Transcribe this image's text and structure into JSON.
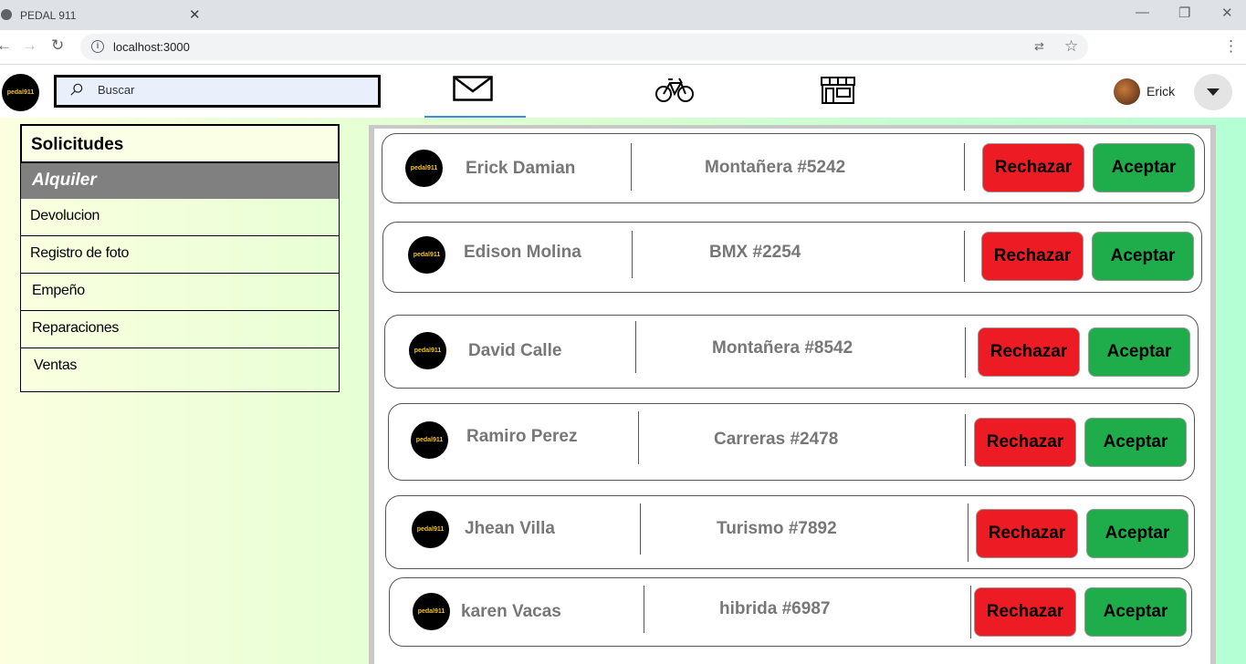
{
  "browser": {
    "tab_title": "PEDAL 911",
    "tab_close": "✕",
    "url": "localhost:3000",
    "controls": {
      "minimize": "—",
      "restore": "❐",
      "close": "✕"
    }
  },
  "header": {
    "logo_text": "pedal911",
    "search_placeholder": "Buscar",
    "user_name": "Erick",
    "nav_icons": [
      "mail-icon",
      "bicycle-icon",
      "store-icon"
    ]
  },
  "sidebar": {
    "title": "Solicitudes",
    "active": "Alquiler",
    "items": [
      "Devolucion",
      "Registro de foto",
      "Empeño",
      "Reparaciones",
      "Ventas"
    ]
  },
  "requests": [
    {
      "name": "Erick Damian",
      "bike": "Montañera #5242"
    },
    {
      "name": "Edison  Molina",
      "bike": "BMX #2254"
    },
    {
      "name": "David Calle",
      "bike": "Montañera  #8542"
    },
    {
      "name": "Ramiro Perez",
      "bike": "Carreras #2478"
    },
    {
      "name": "Jhean Villa",
      "bike": "Turismo #7892"
    },
    {
      "name": "karen Vacas",
      "bike": "hibrida #6987"
    }
  ],
  "buttons": {
    "reject": "Rechazar",
    "accept": "Aceptar"
  },
  "colors": {
    "reject": "#ed1c24",
    "accept": "#1fac4b",
    "sidebar_active": "#808080"
  }
}
